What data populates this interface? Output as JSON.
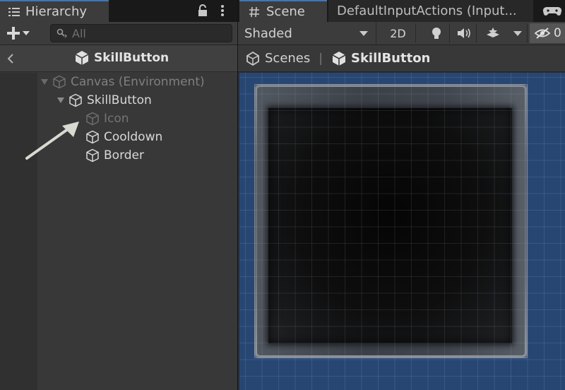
{
  "hierarchy": {
    "tab_label": "Hierarchy",
    "search_placeholder": "All",
    "prefab_title": "SkillButton",
    "tree": [
      {
        "label": "Canvas (Environment)",
        "depth": 0,
        "state": "dimmed",
        "expanded": true
      },
      {
        "label": "SkillButton",
        "depth": 1,
        "state": "normal",
        "expanded": true
      },
      {
        "label": "Icon",
        "depth": 2,
        "state": "inactive"
      },
      {
        "label": "Cooldown",
        "depth": 2,
        "state": "normal"
      },
      {
        "label": "Border",
        "depth": 2,
        "state": "normal"
      }
    ]
  },
  "scene": {
    "tabs": [
      {
        "label": "Scene",
        "icon": "hash-icon",
        "active": true
      },
      {
        "label": "DefaultInputActions (Input...",
        "icon": null,
        "active": false
      }
    ],
    "toolbar": {
      "shading_mode": "Shaded",
      "mode_2d": "2D",
      "hidden_count": "0"
    },
    "breadcrumb": {
      "root": "Scenes",
      "current": "SkillButton"
    }
  },
  "colors": {
    "accent": "#3a79bb",
    "panel_bg": "#383838",
    "viewport_bg": "#284672"
  }
}
